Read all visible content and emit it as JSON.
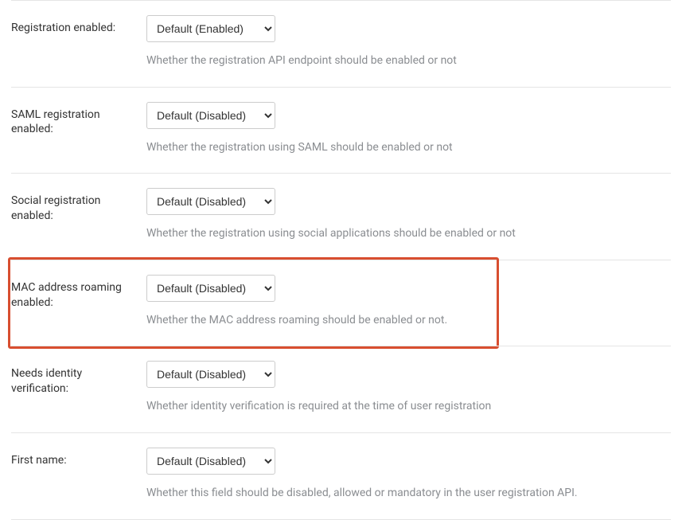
{
  "rows": [
    {
      "key": "registration-enabled",
      "label": "Registration enabled:",
      "value": "Default (Enabled)",
      "help": "Whether the registration API endpoint should be enabled or not"
    },
    {
      "key": "saml-registration-enabled",
      "label": "SAML registration enabled:",
      "value": "Default (Disabled)",
      "help": "Whether the registration using SAML should be enabled or not"
    },
    {
      "key": "social-registration-enabled",
      "label": "Social registration enabled:",
      "value": "Default (Disabled)",
      "help": "Whether the registration using social applications should be enabled or not"
    },
    {
      "key": "mac-address-roaming-enabled",
      "label": "MAC address roaming enabled:",
      "value": "Default (Disabled)",
      "help": "Whether the MAC address roaming should be enabled or not."
    },
    {
      "key": "needs-identity-verification",
      "label": "Needs identity verification:",
      "value": "Default (Disabled)",
      "help": "Whether identity verification is required at the time of user registration"
    },
    {
      "key": "first-name",
      "label": "First name:",
      "value": "Default (Disabled)",
      "help": "Whether this field should be disabled, allowed or mandatory in the user registration API."
    }
  ]
}
